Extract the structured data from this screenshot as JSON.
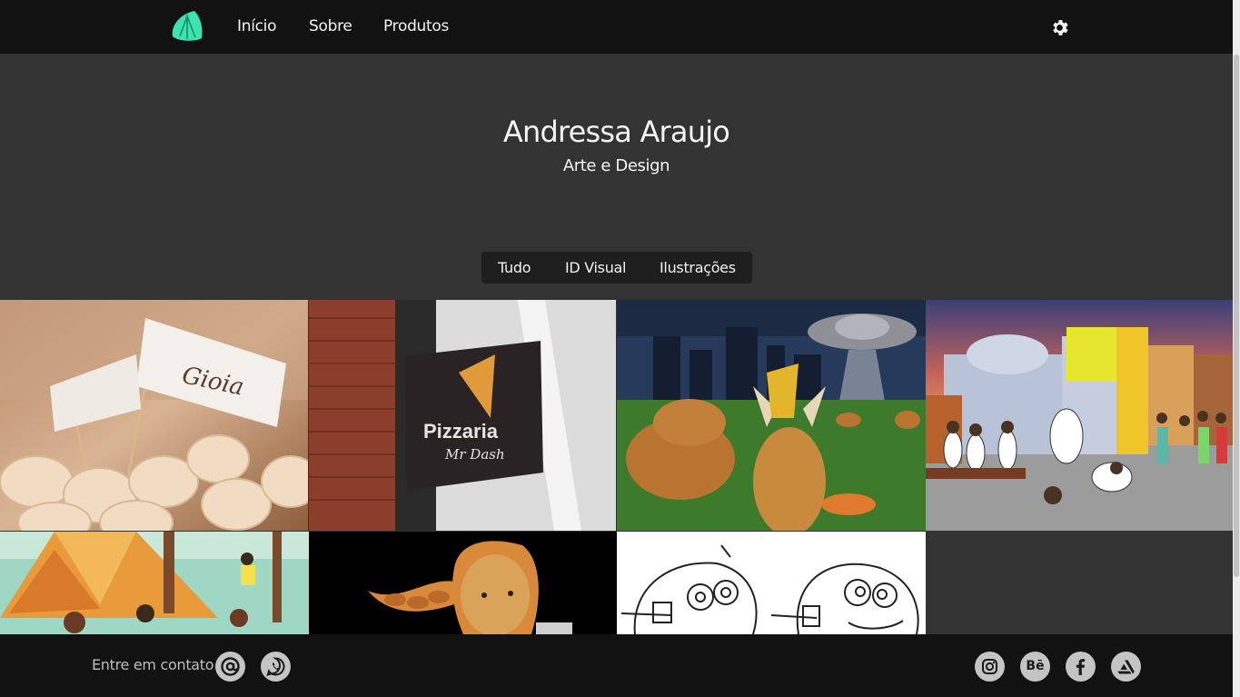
{
  "nav": {
    "links": [
      "Início",
      "Sobre",
      "Produtos"
    ]
  },
  "hero": {
    "title": "Andressa Araujo",
    "subtitle": "Arte e  Design"
  },
  "filters": [
    "Tudo",
    "ID Visual",
    "Ilustrações"
  ],
  "gallery": {
    "tile_texts": {
      "flag": "Gioia",
      "sign_line1": "Pizzaria",
      "sign_line2": "Mr Dash"
    }
  },
  "footer": {
    "contact_label": "Entre em contato",
    "behance_label": "Bē"
  },
  "colors": {
    "navbar": "#121212",
    "page": "#333333",
    "accent": "#3be3b0"
  }
}
